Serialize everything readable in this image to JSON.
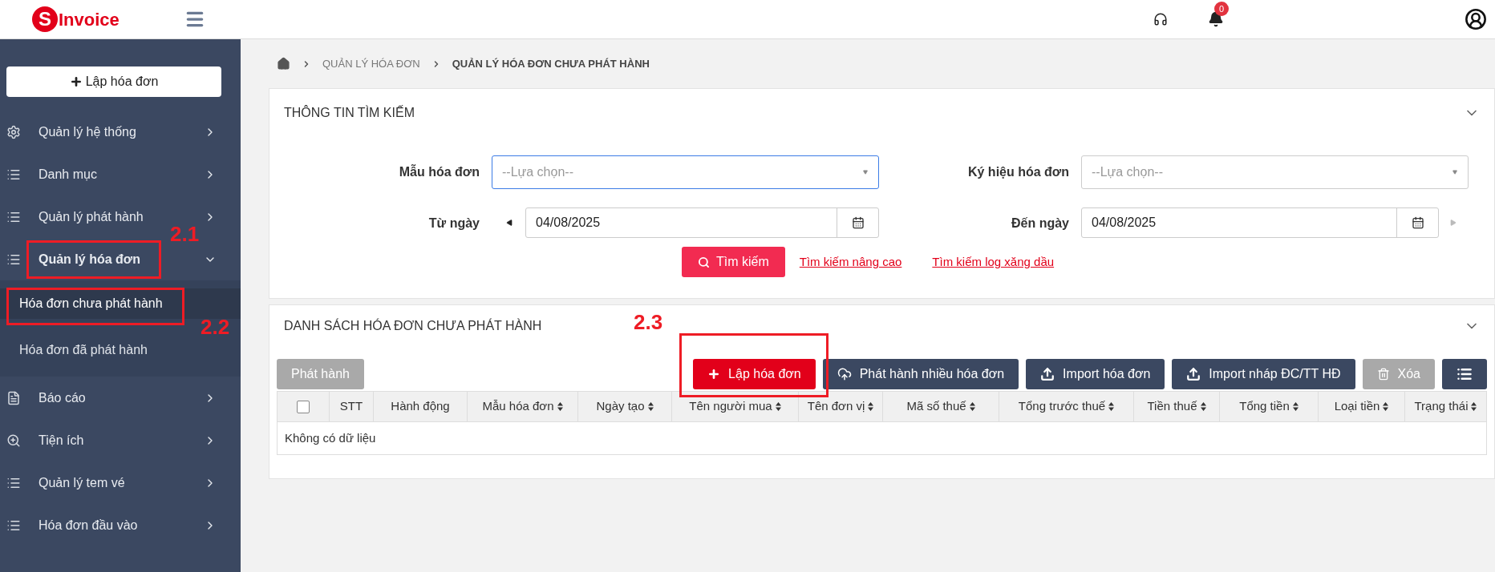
{
  "header": {
    "logo": {
      "letter": "S",
      "text": "Invoice"
    },
    "notification_count": "0"
  },
  "sidebar": {
    "create_button": "Lập hóa đơn",
    "items": [
      {
        "label": "Quản lý hệ thống",
        "kind": "gear",
        "expanded": false
      },
      {
        "label": "Danh mục",
        "kind": "list",
        "expanded": false
      },
      {
        "label": "Quản lý phát hành",
        "kind": "list",
        "expanded": false
      },
      {
        "label": "Quản lý hóa đơn",
        "kind": "list",
        "expanded": true,
        "annotation": "2.1",
        "children": [
          {
            "label": "Hóa đơn chưa phát hành",
            "selected": true,
            "annotation": "2.2"
          },
          {
            "label": "Hóa đơn đã phát hành",
            "selected": false
          }
        ]
      },
      {
        "label": "Báo cáo",
        "kind": "report",
        "expanded": false
      },
      {
        "label": "Tiện ích",
        "kind": "zoom",
        "expanded": false
      },
      {
        "label": "Quản lý tem vé",
        "kind": "list",
        "expanded": false
      },
      {
        "label": "Hóa đơn đầu vào",
        "kind": "list",
        "expanded": false
      }
    ]
  },
  "breadcrumb": [
    "QUẢN LÝ HÓA ĐƠN",
    "QUẢN LÝ HÓA ĐƠN CHƯA PHÁT HÀNH"
  ],
  "search_panel": {
    "title": "THÔNG TIN TÌM KIẾM",
    "template": {
      "label": "Mẫu hóa đơn",
      "placeholder": "--Lựa chọn--",
      "focused": true
    },
    "symbol": {
      "label": "Ký hiệu hóa đơn",
      "placeholder": "--Lựa chọn--",
      "focused": false
    },
    "from_date": {
      "label": "Từ ngày",
      "value": "04/08/2025"
    },
    "to_date": {
      "label": "Đến ngày",
      "value": "04/08/2025"
    },
    "search_button": "Tìm kiếm",
    "links": [
      "Tìm kiếm nâng cao",
      "Tìm kiếm log xăng dầu"
    ]
  },
  "list_panel": {
    "title": "DANH SÁCH HÓA ĐƠN CHƯA PHÁT HÀNH",
    "issue_button": {
      "label": "Phát hành",
      "disabled": true
    },
    "buttons": [
      {
        "label": "Lập hóa đơn",
        "kind": "create",
        "disabled": false,
        "annotation": "2.3"
      },
      {
        "label": "Phát hành nhiều hóa đơn",
        "kind": "cloud",
        "disabled": false
      },
      {
        "label": "Import hóa đơn",
        "kind": "upload",
        "disabled": false
      },
      {
        "label": "Import nháp ĐC/TT HĐ",
        "kind": "upload",
        "disabled": false
      },
      {
        "label": "Xóa",
        "kind": "delete",
        "disabled": true
      },
      {
        "kind": "columns",
        "disabled": false
      }
    ],
    "table": {
      "select_all": {
        "checked": false
      },
      "columns": [
        {
          "label": "STT",
          "sortable": false
        },
        {
          "label": "Hành động",
          "sortable": false
        },
        {
          "label": "Mẫu hóa đơn",
          "sortable": true
        },
        {
          "label": "Ngày tạo",
          "sortable": true
        },
        {
          "label": "Tên người mua",
          "sortable": true
        },
        {
          "label": "Tên đơn vị",
          "sortable": true
        },
        {
          "label": "Mã số thuế",
          "sortable": true
        },
        {
          "label": "Tổng trước thuế",
          "sortable": true
        },
        {
          "label": "Tiền thuế",
          "sortable": true
        },
        {
          "label": "Tổng tiền",
          "sortable": true
        },
        {
          "label": "Loại tiền",
          "sortable": true
        },
        {
          "label": "Trạng thái",
          "sortable": true
        }
      ],
      "empty_text": "Không có dữ liệu"
    }
  }
}
